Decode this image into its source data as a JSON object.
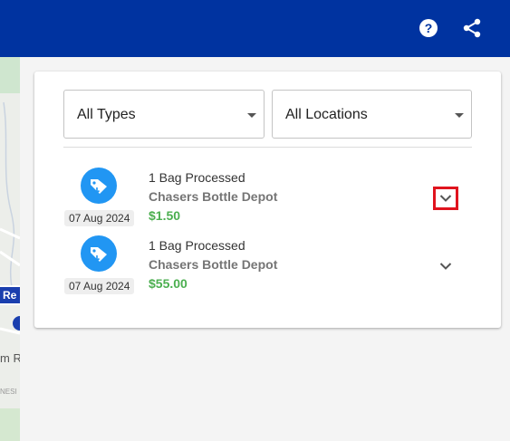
{
  "header": {
    "help_icon": "help-circle-icon",
    "share_icon": "share-icon",
    "background_color": "#0033a0"
  },
  "filters": {
    "types": {
      "selected": "All Types"
    },
    "locations": {
      "selected": "All Locations"
    }
  },
  "transactions": [
    {
      "title": "1 Bag Processed",
      "location": "Chasers Bottle Depot",
      "amount": "$1.50",
      "date": "07 Aug 2024",
      "icon": "tag-icon"
    },
    {
      "title": "1 Bag Processed",
      "location": "Chasers Bottle Depot",
      "amount": "$55.00",
      "date": "07 Aug 2024",
      "icon": "tag-icon"
    }
  ],
  "colors": {
    "accent_blue": "#2196f3",
    "amount_green": "#4caf50",
    "highlight_red": "#e0141e"
  }
}
